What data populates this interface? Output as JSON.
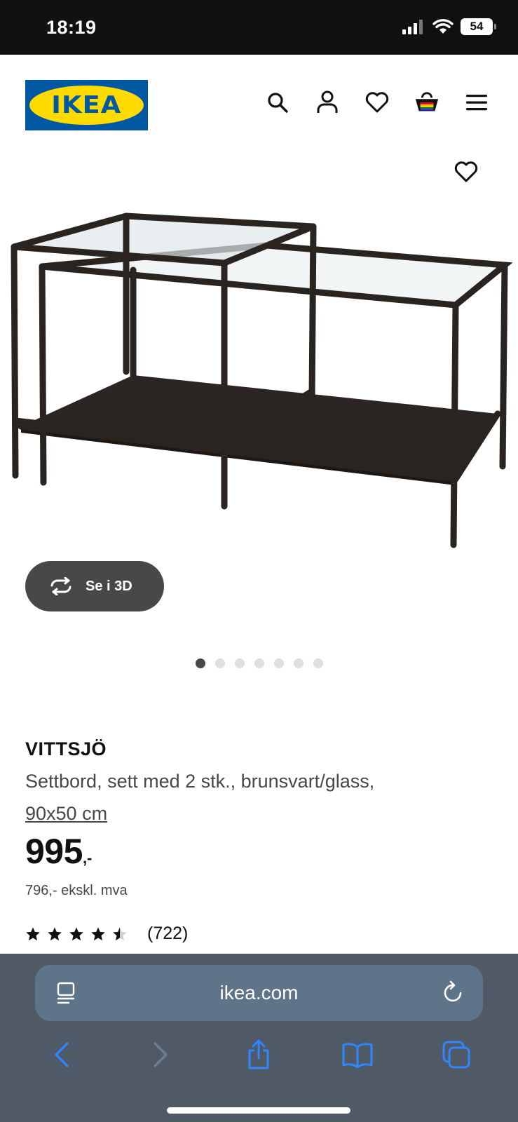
{
  "status_bar": {
    "time": "18:19",
    "battery": "54"
  },
  "brand": {
    "logo_text": "IKEA",
    "logo_blue": "#0058a3",
    "logo_yellow": "#ffdb00"
  },
  "header": {
    "icons": [
      "search-icon",
      "account-icon",
      "heart-icon",
      "basket-icon",
      "menu-icon"
    ]
  },
  "gallery": {
    "view_3d_label": "Se i 3D",
    "dot_count": 7,
    "active_dot": 1
  },
  "product": {
    "name": "VITTSJÖ",
    "description": "Settbord, sett med 2 stk., brunsvart/glass,",
    "size": "90x50 cm",
    "price": "995",
    "price_suffix": ",-",
    "price_ex_vat": "796,- ekskl. mva",
    "rating": 4.5,
    "rating_count": "(722)"
  },
  "browser": {
    "url": "ikea.com"
  }
}
